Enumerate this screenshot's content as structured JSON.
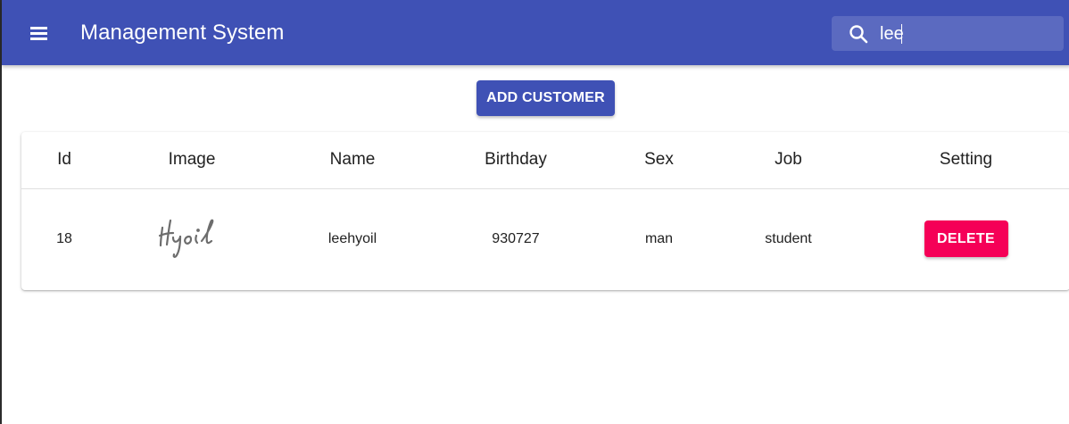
{
  "appbar": {
    "title": "Management System",
    "menu_icon": "menu-icon",
    "search": {
      "icon": "search-icon",
      "value": "lee",
      "placeholder": ""
    }
  },
  "actions": {
    "add_customer_label": "ADD CUSTOMER"
  },
  "table": {
    "headers": [
      "Id",
      "Image",
      "Name",
      "Birthday",
      "Sex",
      "Job",
      "Setting"
    ],
    "rows": [
      {
        "id": "18",
        "image_signature": "Hyoil",
        "name": "leehyoil",
        "birthday": "930727",
        "sex": "man",
        "job": "student",
        "delete_label": "DELETE"
      }
    ]
  },
  "colors": {
    "primary": "#3f51b5",
    "secondary": "#f50057",
    "text": "#212121"
  }
}
